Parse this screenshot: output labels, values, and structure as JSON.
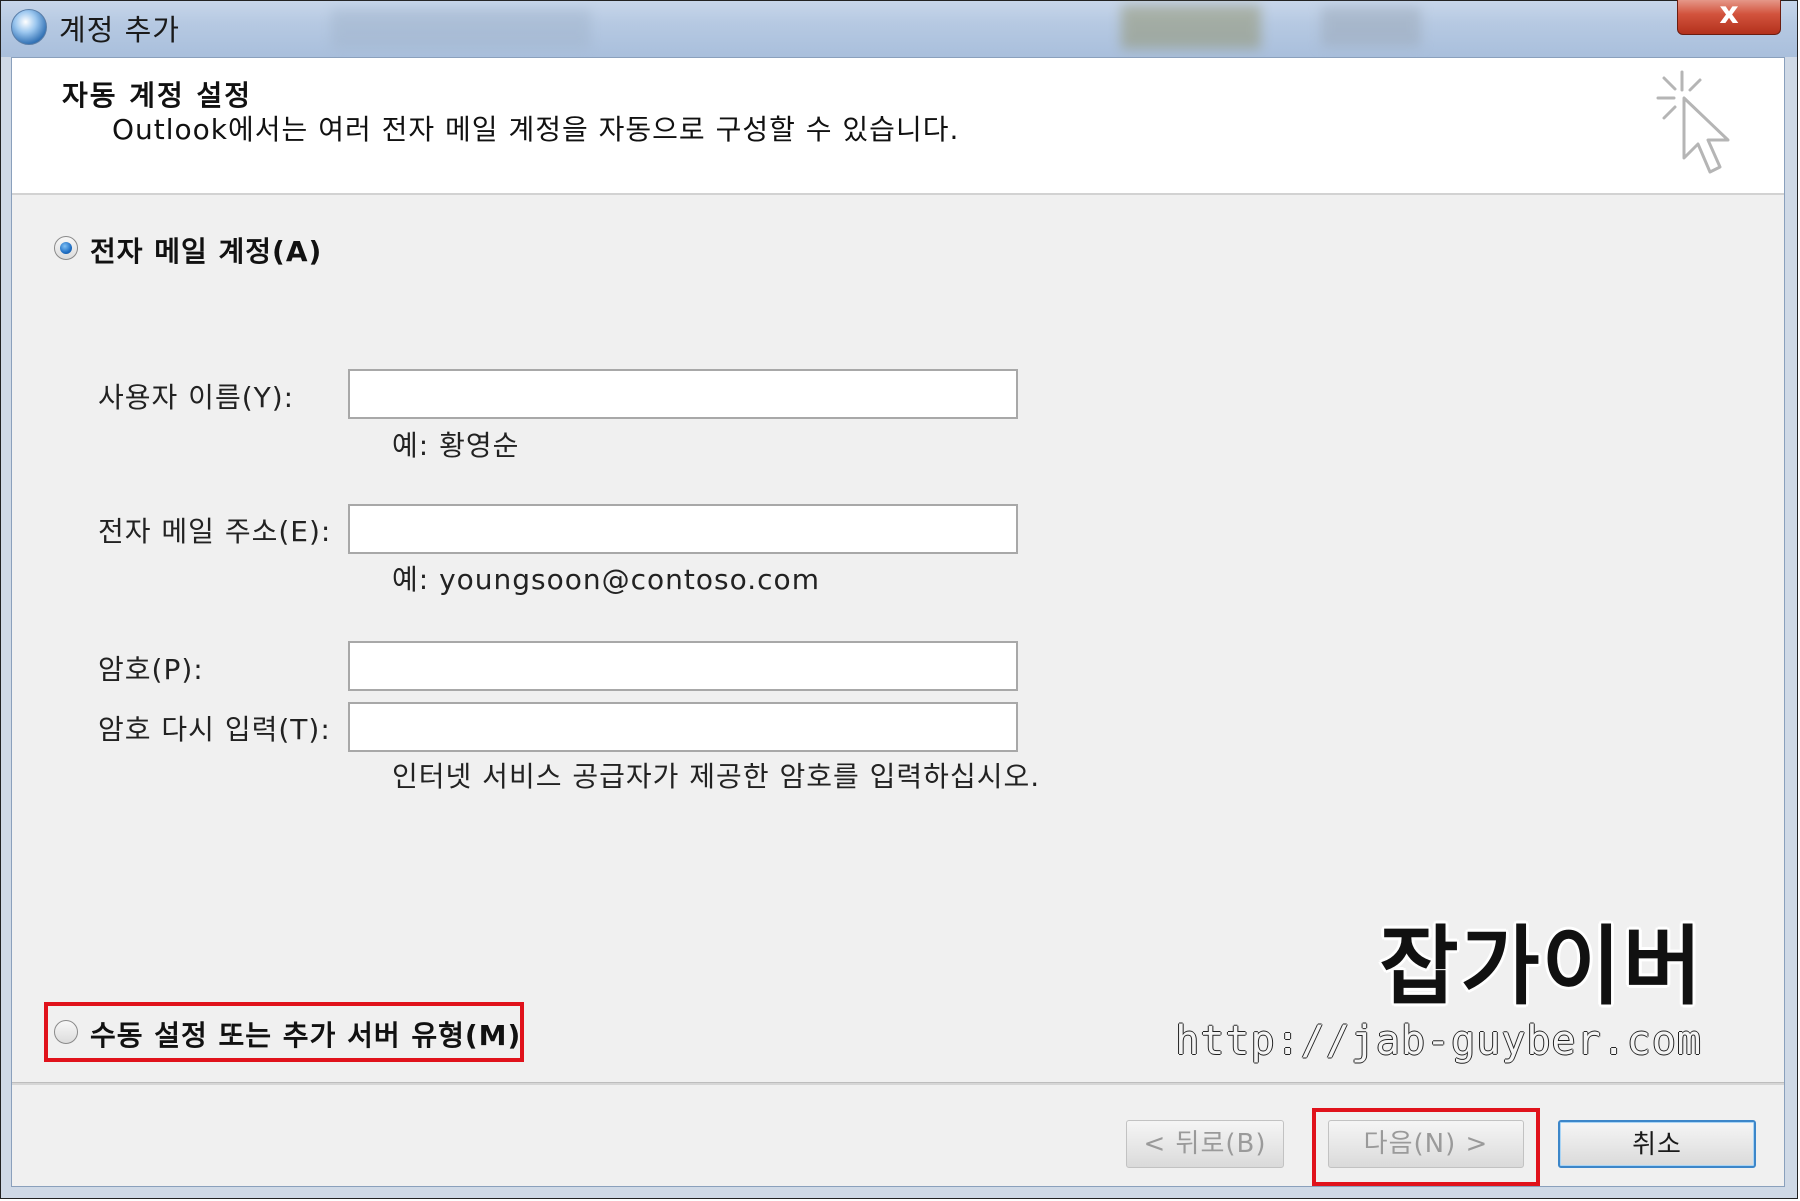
{
  "window": {
    "title": "계정 추가",
    "close_label": "x"
  },
  "header": {
    "title": "자동 계정 설정",
    "subtitle": "Outlook에서는 여러 전자 메일 계정을 자동으로 구성할 수 있습니다."
  },
  "options": {
    "email_account": {
      "label": "전자 메일 계정(A)",
      "selected": true
    },
    "manual_setup": {
      "label": "수동 설정 또는 추가 서버 유형(M)",
      "selected": false
    }
  },
  "form": {
    "username": {
      "label": "사용자 이름(Y):",
      "value": "",
      "hint": "예: 황영순"
    },
    "email": {
      "label": "전자 메일 주소(E):",
      "value": "",
      "hint": "예: youngsoon@contoso.com"
    },
    "password": {
      "label": "암호(P):",
      "value": ""
    },
    "password_confirm": {
      "label": "암호 다시 입력(T):",
      "value": ""
    },
    "password_hint": "인터넷 서비스 공급자가 제공한 암호를 입력하십시오."
  },
  "watermark": {
    "name": "잡가이버",
    "url": "http://jab-guyber.com"
  },
  "buttons": {
    "back": "< 뒤로(B)",
    "next": "다음(N) >",
    "cancel": "취소"
  },
  "colors": {
    "highlight": "#e0121b",
    "accent": "#3c86c9"
  }
}
